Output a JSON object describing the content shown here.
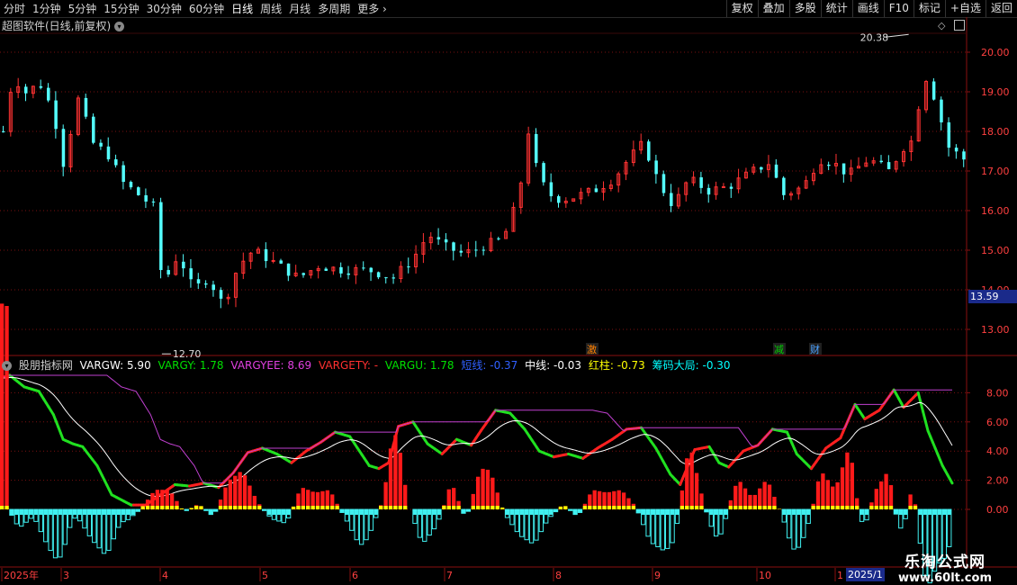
{
  "toolbar": {
    "periods": [
      "分时",
      "1分钟",
      "5分钟",
      "15分钟",
      "30分钟",
      "60分钟",
      "日线",
      "周线",
      "月线",
      "多周期",
      "更多"
    ],
    "more_chevron": "chevron-right-icon",
    "tools": [
      "复权",
      "叠加",
      "多股",
      "统计",
      "画线",
      "F10",
      "标记",
      "+自选",
      "返回"
    ]
  },
  "main_chart": {
    "title": "超图软件(日线,前复权)",
    "y_axis": [
      "20.00",
      "19.00",
      "18.00",
      "17.00",
      "16.00",
      "15.00",
      "14.00",
      "13.00"
    ],
    "high_label": "20.38",
    "low_label": "12.70",
    "current_price": "13.59",
    "markers": [
      {
        "text": "激",
        "color": "#ff8000"
      },
      {
        "text": "减",
        "color": "#00d000"
      },
      {
        "text": "财",
        "color": "#4aa0ff"
      }
    ]
  },
  "indicator": {
    "name": "股朋指标网",
    "values": [
      {
        "label": "VARGW: 5.90",
        "color": "#ffffff"
      },
      {
        "label": "VARGY: 1.78",
        "color": "#00e000"
      },
      {
        "label": "VARGYEE: 8.69",
        "color": "#e040e0"
      },
      {
        "label": "VARGETY: -",
        "color": "#ff3030"
      },
      {
        "label": "VARGU: 1.78",
        "color": "#00e000"
      },
      {
        "label": "短线: -0.37",
        "color": "#3060ff"
      },
      {
        "label": "中线: -0.03",
        "color": "#ffffff"
      },
      {
        "label": "红柱: -0.73",
        "color": "#ffff00"
      },
      {
        "label": "筹码大局: -0.30",
        "color": "#00ffff"
      }
    ],
    "y_axis": [
      "8.00",
      "6.00",
      "4.00",
      "2.00",
      "0.00"
    ]
  },
  "x_axis": {
    "labels": [
      "2025年",
      "3",
      "4",
      "5",
      "6",
      "7",
      "8",
      "9",
      "10",
      "1"
    ],
    "cursor_label": "2025/1"
  },
  "watermark": {
    "line1": "乐淘公式网",
    "line2": "www.60lt.com"
  },
  "colors": {
    "up": "#ff3232",
    "down": "#54ffff",
    "grid": "#7a1010",
    "purple": "#c040d0"
  }
}
